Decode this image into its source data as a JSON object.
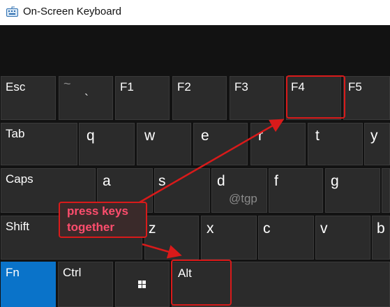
{
  "window": {
    "title": "On-Screen Keyboard"
  },
  "keys": {
    "esc": "Esc",
    "tilde_top": "~",
    "tilde_bottom": "`",
    "f1": "F1",
    "f2": "F2",
    "f3": "F3",
    "f4": "F4",
    "f5": "F5",
    "tab": "Tab",
    "q": "q",
    "w": "w",
    "e": "e",
    "r": "r",
    "t": "t",
    "y": "y",
    "caps": "Caps",
    "a": "a",
    "s": "s",
    "d": "d",
    "f": "f",
    "g": "g",
    "shift": "Shift",
    "z": "z",
    "x": "x",
    "c": "c",
    "v": "v",
    "b": "b",
    "fn": "Fn",
    "ctrl": "Ctrl",
    "alt": "Alt"
  },
  "annotation": {
    "line1": "press keys",
    "line2": "together"
  },
  "watermark": "@tgp",
  "colors": {
    "accent": "#0a73c9",
    "annotation": "#d91a1a",
    "annotation_text": "#ff4d6d"
  },
  "icons": {
    "app": "keyboard-icon",
    "windows": "windows-logo-icon"
  }
}
